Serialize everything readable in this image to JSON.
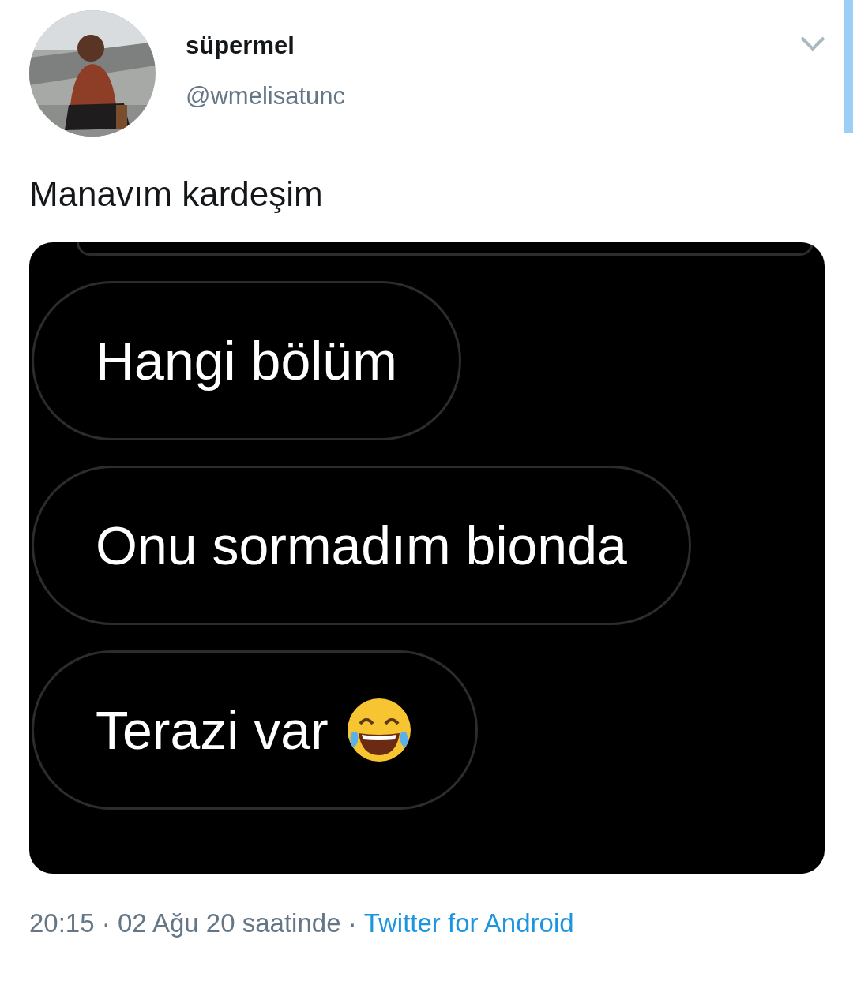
{
  "author": {
    "name": "süpermel",
    "handle": "@wmelisatunc"
  },
  "tweet": {
    "text": "Manavım kardeşim",
    "attachment": {
      "messages": [
        {
          "text": "Hangi bölüm",
          "emoji": false
        },
        {
          "text": "Onu sormadım bionda",
          "emoji": false
        },
        {
          "text": "Terazi var",
          "emoji": true
        }
      ]
    }
  },
  "footer": {
    "meta": "20:15 · 02 Ağu 20 saatinde ·",
    "source": "Twitter for Android"
  }
}
